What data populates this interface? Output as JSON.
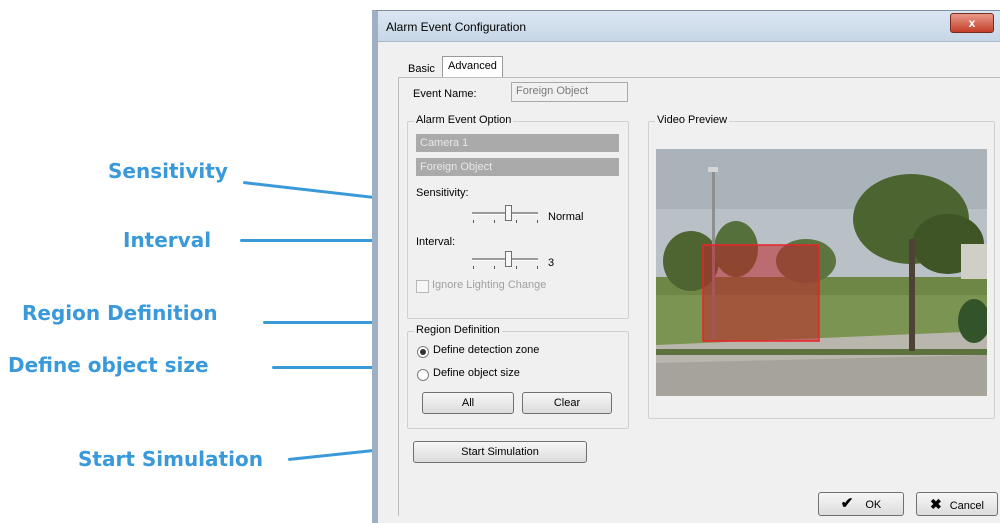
{
  "window": {
    "title": "Alarm Event Configuration",
    "close_label": "x"
  },
  "tabs": [
    {
      "label": "Basic",
      "active": false
    },
    {
      "label": "Advanced",
      "active": true
    }
  ],
  "event_name": {
    "label": "Event Name:",
    "value": "Foreign Object"
  },
  "alarm_option": {
    "title": "Alarm Event Option",
    "camera": "Camera 1",
    "event_type": "Foreign Object",
    "sensitivity_label": "Sensitivity:",
    "sensitivity_value": "Normal",
    "interval_label": "Interval:",
    "interval_value": "3",
    "ignore_lighting_label": "Ignore Lighting Change",
    "ignore_lighting_checked": false
  },
  "region": {
    "title": "Region Definition",
    "options": [
      {
        "label": "Define detection zone",
        "selected": true
      },
      {
        "label": "Define object size",
        "selected": false
      }
    ],
    "all_label": "All",
    "clear_label": "Clear"
  },
  "start_simulation_label": "Start Simulation",
  "video": {
    "title": "Video Preview"
  },
  "footer": {
    "ok_label": "OK",
    "cancel_label": "Cancel"
  },
  "callouts": {
    "sensitivity": "Sensitivity",
    "interval": "Interval",
    "region": "Region Definition",
    "object_size": "Define object size",
    "simulation": "Start Simulation"
  },
  "colors": {
    "callout": "#3a9ad9",
    "detection_zone": "#c0242a"
  }
}
